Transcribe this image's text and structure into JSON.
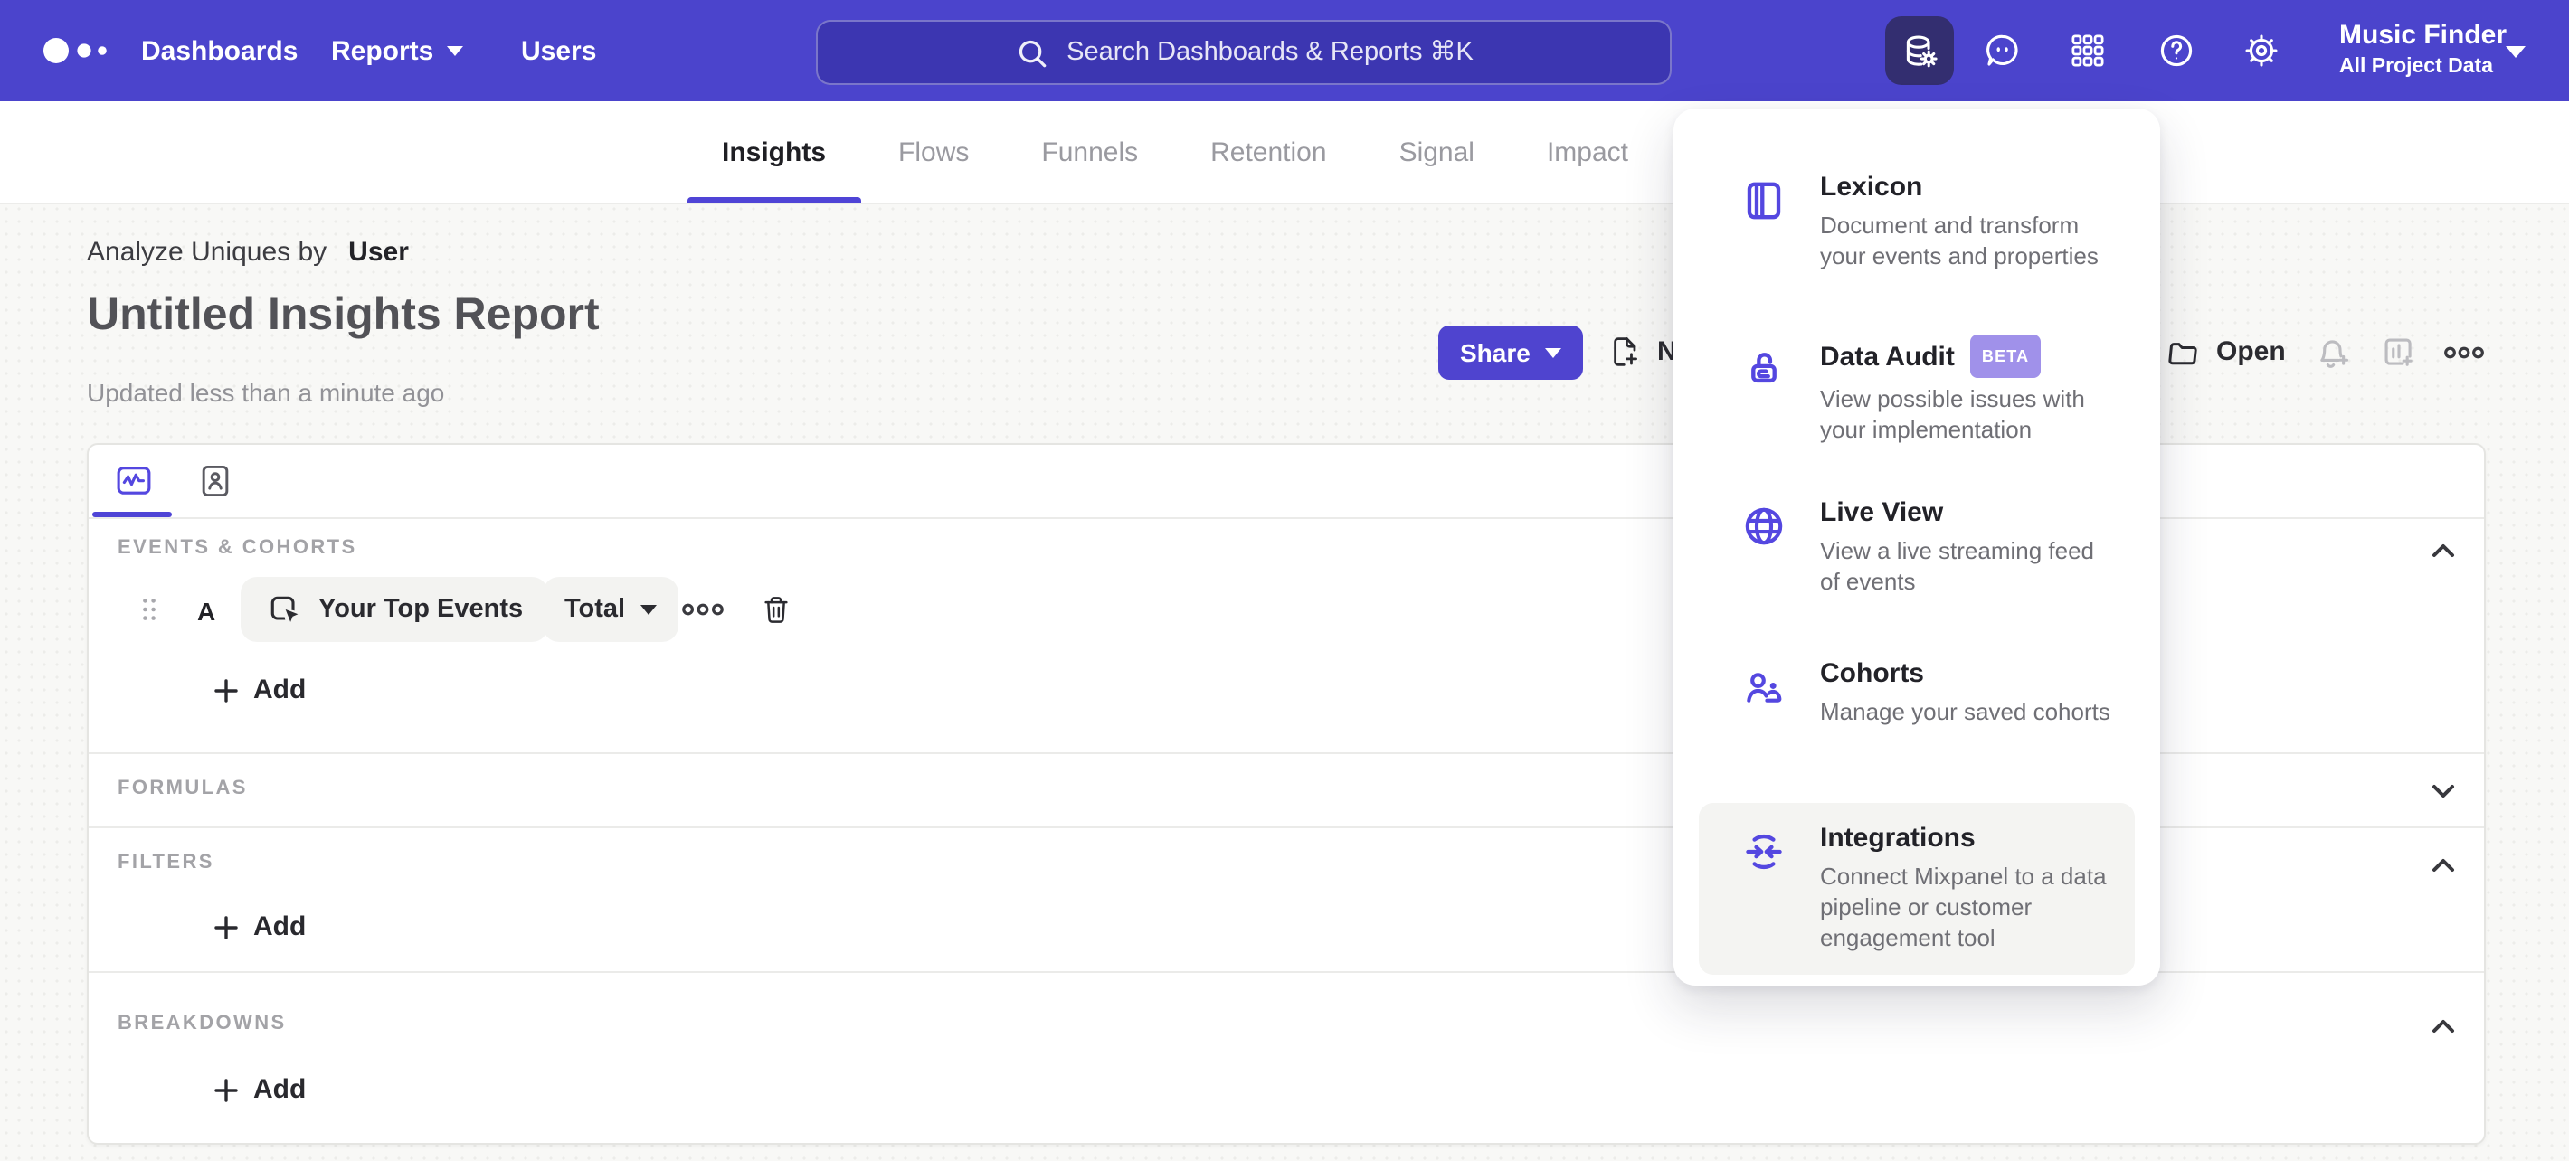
{
  "nav": {
    "links": [
      {
        "label": "Dashboards"
      },
      {
        "label": "Reports"
      },
      {
        "label": "Users"
      }
    ],
    "search": {
      "placeholder": "Search Dashboards & Reports ⌘K"
    },
    "project": {
      "name": "Music Finder",
      "scope": "All Project Data"
    }
  },
  "tabs": {
    "items": [
      {
        "label": "Insights"
      },
      {
        "label": "Flows"
      },
      {
        "label": "Funnels"
      },
      {
        "label": "Retention"
      },
      {
        "label": "Signal"
      },
      {
        "label": "Impact"
      }
    ]
  },
  "report": {
    "breadcrumb_label": "Analyze Uniques by",
    "breadcrumb_value": "User",
    "title": "Untitled Insights Report",
    "updated": "Updated less than a minute ago"
  },
  "actions": {
    "share_label": "Share",
    "new_label": "New",
    "open_label": "Open"
  },
  "builder": {
    "sections": {
      "events": {
        "label": "EVENTS & COHORTS"
      },
      "formulas": {
        "label": "FORMULAS"
      },
      "filters": {
        "label": "FILTERS"
      },
      "breakdowns": {
        "label": "BREAKDOWNS"
      }
    },
    "event_row": {
      "letter": "A",
      "event_label": "Your Top Events",
      "metric_label": "Total"
    },
    "add_label": "Add"
  },
  "menu": {
    "items": [
      {
        "title": "Lexicon",
        "desc": "Document and transform your events and properties"
      },
      {
        "title": "Data Audit",
        "badge": "BETA",
        "desc": "View possible issues with your implementation"
      },
      {
        "title": "Live View",
        "desc": "View a live streaming feed of events"
      },
      {
        "title": "Cohorts",
        "desc": "Manage your saved cohorts"
      },
      {
        "title": "Integrations",
        "desc": "Connect Mixpanel to a data pipeline or customer engagement tool"
      }
    ]
  },
  "colors": {
    "nav_purple": "#4b44cc",
    "accent_purple": "#4f44d6",
    "menu_icon_purple": "#5447e0",
    "beta_badge": "#a091ea",
    "active_tile": "#332e70",
    "page_bg": "#f8f8f6"
  },
  "icons": {
    "mixpanel-logo": "three dots",
    "search-icon": "magnifier",
    "data-management-icon": "database+gear",
    "feedback-icon": "speech bubble",
    "apps-grid-icon": "3x3 grid",
    "help-icon": "question circle",
    "settings-icon": "gear",
    "new-report-icon": "document plus",
    "open-icon": "folder",
    "alert-icon": "bell plus",
    "add-to-board-icon": "chart plus",
    "more-icon": "ooo",
    "trash-icon": "trash can",
    "drag-handle-icon": "dot grid",
    "event-icon": "cursor click",
    "chart-tab-icon": "pulse square",
    "profile-tab-icon": "person card",
    "lexicon-icon": "book",
    "data-audit-icon": "lock spiral",
    "live-view-icon": "globe",
    "cohorts-icon": "two people",
    "integrations-icon": "sync arrows circle"
  }
}
